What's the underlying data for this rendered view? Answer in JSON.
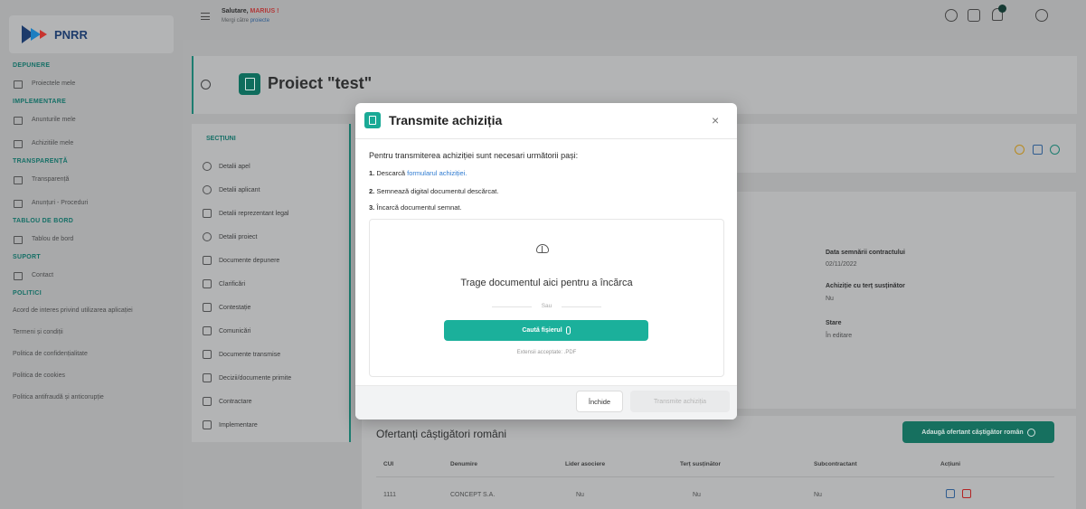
{
  "brand": {
    "name": "PNRR"
  },
  "sidebar": {
    "groups": [
      {
        "heading": "DEPUNERE",
        "items": [
          "Proiectele mele"
        ]
      },
      {
        "heading": "IMPLEMENTARE",
        "items": [
          "Anunturile mele",
          "Achizitiile mele"
        ]
      },
      {
        "heading": "TRANSPARENȚĂ",
        "items": [
          "Transparență",
          "Anunțuri - Proceduri"
        ]
      },
      {
        "heading": "TABLOU DE BORD",
        "items": [
          "Tablou de bord"
        ]
      },
      {
        "heading": "SUPORT",
        "items": [
          "Contact"
        ]
      },
      {
        "heading": "POLITICI",
        "items": []
      }
    ],
    "links": [
      "Acord de interes privind utilizarea aplicației",
      "Termeni și condiții",
      "Politica de confidențialitate",
      "Politica de cookies",
      "Politica antifraudă și anticorupție"
    ]
  },
  "header": {
    "greeting_prefix": "Salutare,",
    "user": "MARIUS !",
    "sub_prefix": "Mergi către",
    "sub_link": "proiecte"
  },
  "page": {
    "title": "Proiect \"test\""
  },
  "sections": {
    "heading": "SECȚIUNI",
    "items": [
      "Detalii apel",
      "Detalii aplicant",
      "Detalii reprezentant legal",
      "Detalii proiect",
      "Documente depunere",
      "Clarificări",
      "Contestație",
      "Comunicări",
      "Documente transmise",
      "Decizii/documente primite",
      "Contractare",
      "Implementare"
    ]
  },
  "details": {
    "items": [
      {
        "label": "Data semnării contractului",
        "value": "02/11/2022"
      },
      {
        "label": "Achiziție cu terț susținător",
        "value": "Nu"
      },
      {
        "label": "Stare",
        "value": "În editare"
      }
    ]
  },
  "offerors": {
    "title": "Ofertanți câștigători români",
    "add_label": "Adaugă ofertant câștigător român",
    "columns": [
      "CUI",
      "Denumire",
      "Lider asociere",
      "Terț susținător",
      "Subcontractant",
      "Acțiuni"
    ],
    "rows": [
      {
        "cui": "1111",
        "name": "CONCEPT S.A.",
        "leader": "Nu",
        "third": "Nu",
        "sub": "Nu"
      }
    ]
  },
  "modal": {
    "title": "Transmite achiziția",
    "close_glyph": "×",
    "intro": "Pentru transmiterea achiziției sunt necesari următorii pași:",
    "step1_num": "1.",
    "step1_text": "Descarcă",
    "step1_link": "formularul achiziției.",
    "step2_num": "2.",
    "step2_text": "Semnează digital documentul descărcat.",
    "step3_num": "3.",
    "step3_text": "Încarcă documentul semnat.",
    "drop_text": "Trage documentul aici pentru a încărca",
    "or_text": "Sau",
    "browse_label": "Caută fișierul",
    "ext_text": "Extensii acceptate: .PDF",
    "close_label": "Închide",
    "send_label": "Transmite achiziția"
  },
  "colors": {
    "accent": "#1bb09b",
    "brand_dark": "#1d3b6b",
    "primary_green": "#16705f"
  }
}
